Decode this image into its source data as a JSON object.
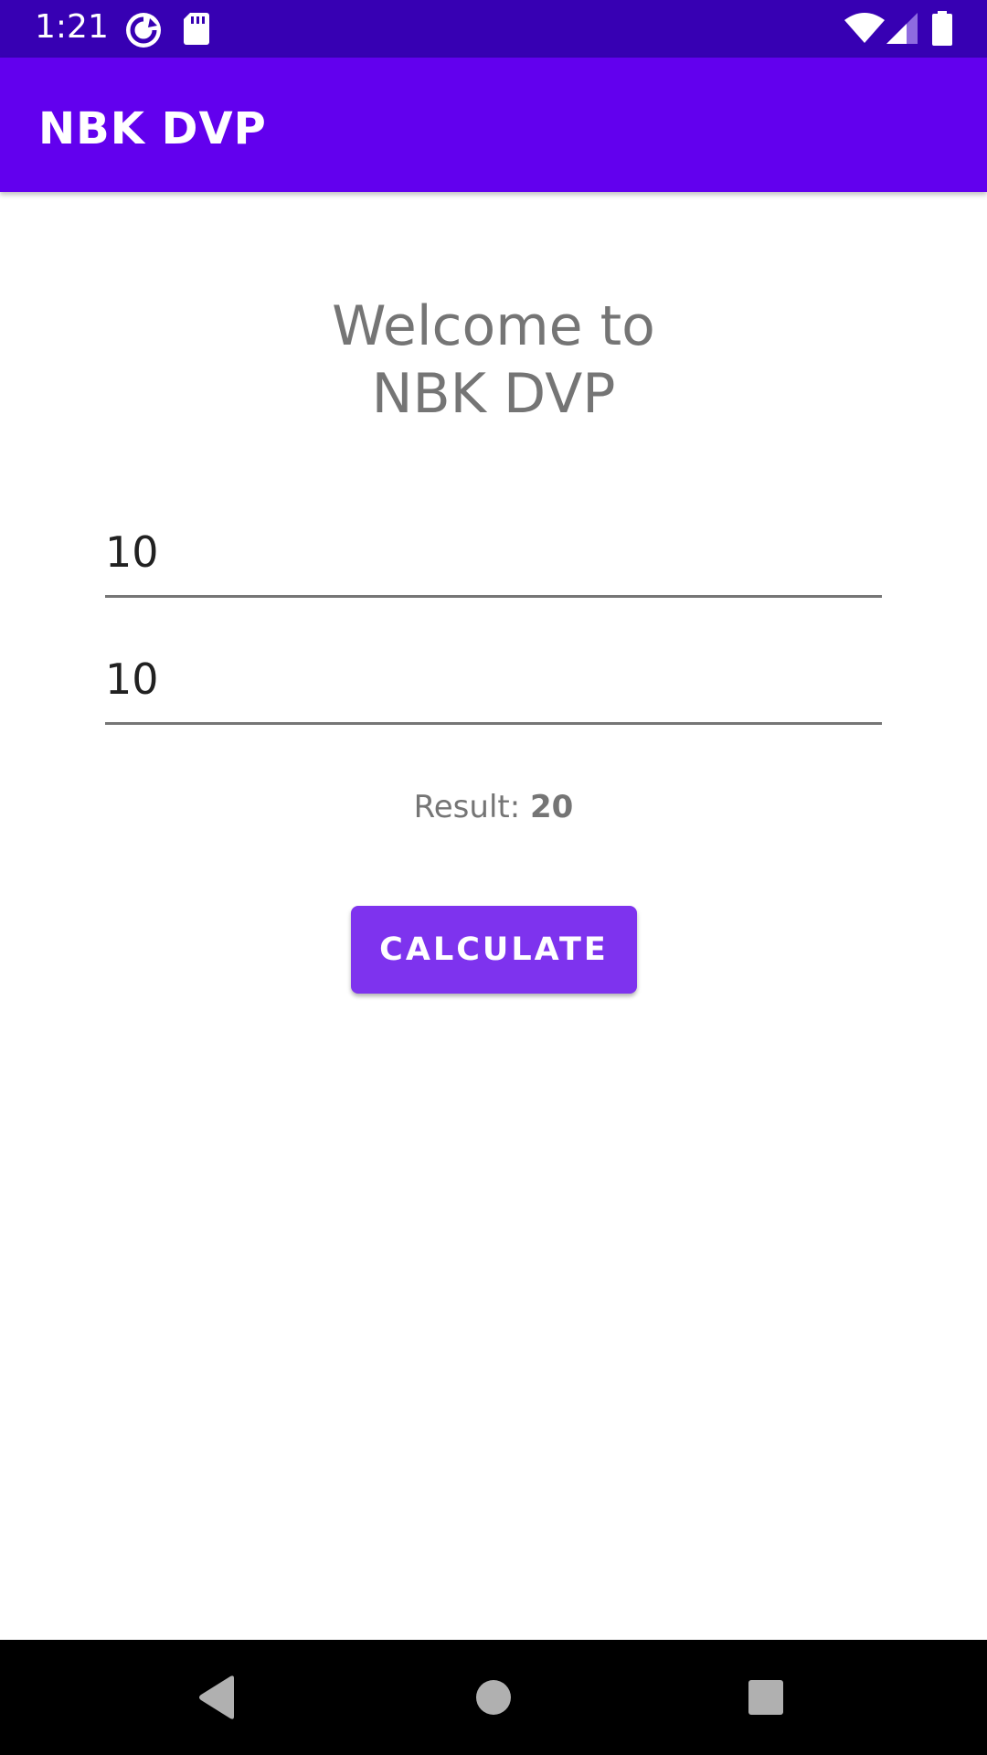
{
  "status_bar": {
    "time": "1:21",
    "icons": [
      "sync-icon",
      "sd-card-icon",
      "wifi-icon",
      "signal-icon",
      "battery-icon"
    ],
    "bg_color": "#3700B3"
  },
  "app_bar": {
    "title": "NBK DVP",
    "bg_color": "#6200EE"
  },
  "main": {
    "welcome_line1": "Welcome to",
    "welcome_line2": "NBK DVP",
    "input1_value": "10",
    "input2_value": "10",
    "result_label": "Result: ",
    "result_value": "20",
    "button_label": "CALCULATE",
    "button_color": "#7E33EE"
  },
  "nav_bar": {
    "icons": [
      "back-icon",
      "home-icon",
      "recents-icon"
    ]
  }
}
